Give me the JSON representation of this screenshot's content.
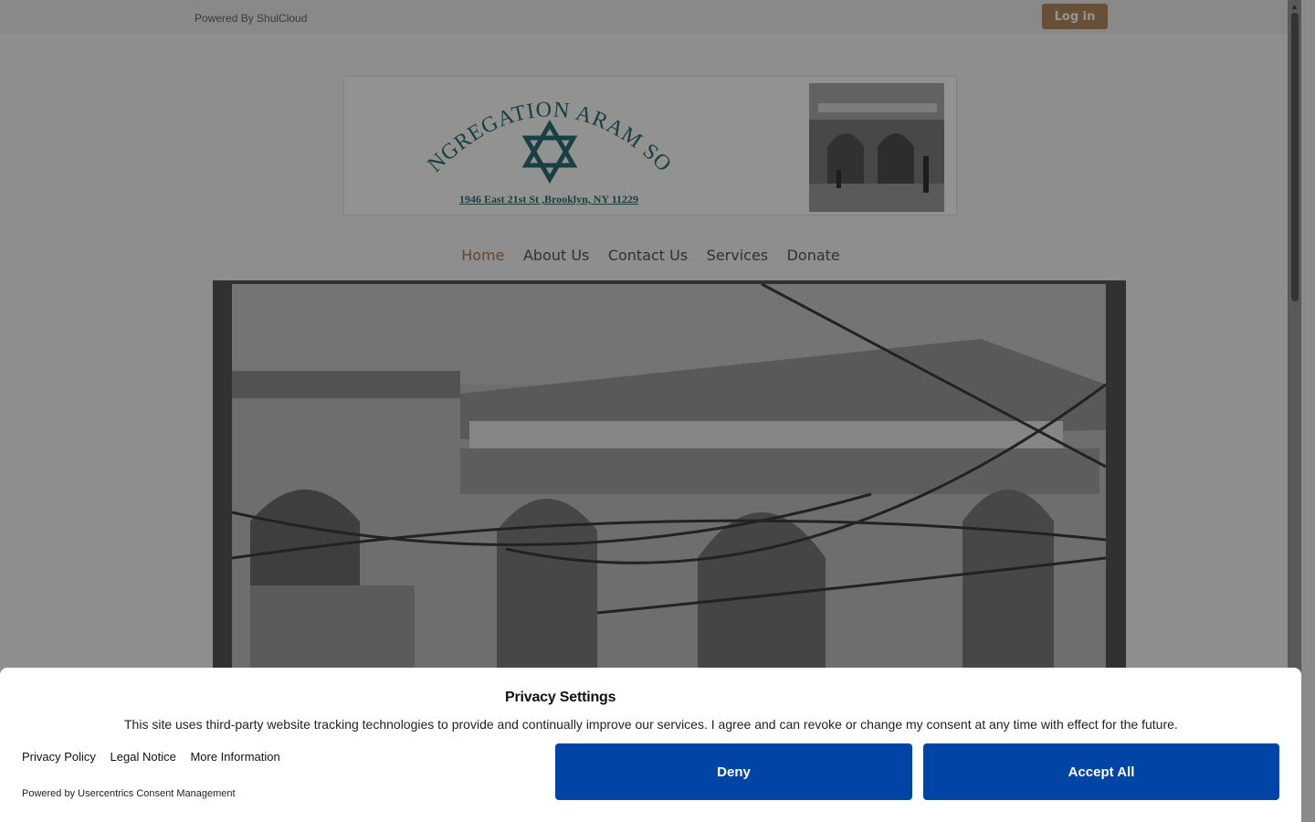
{
  "topbar": {
    "powered_text": "Powered By ShulCloud",
    "login_label": "Log in",
    "login_color": "#b38b5d"
  },
  "logo": {
    "arc_text": "CONGREGATION ARAM SOBA",
    "address": "1946 East 21st St ,Brooklyn, NY 11229",
    "brand_color": "#2a6e76"
  },
  "nav": {
    "items": [
      "Home",
      "About Us",
      "Contact Us",
      "Services",
      "Donate"
    ],
    "active": "Home",
    "active_color": "#b07a4c"
  },
  "consent": {
    "title": "Privacy Settings",
    "description": "This site uses third-party website tracking technologies to provide and continually improve our services. I agree and can revoke or change my consent at any time with effect for the future.",
    "links": {
      "privacy": "Privacy Policy",
      "legal": "Legal Notice",
      "more": "More Information"
    },
    "powered": "Powered by Usercentrics Consent Management",
    "deny_label": "Deny",
    "accept_label": "Accept All",
    "button_color": "#0045a5"
  }
}
